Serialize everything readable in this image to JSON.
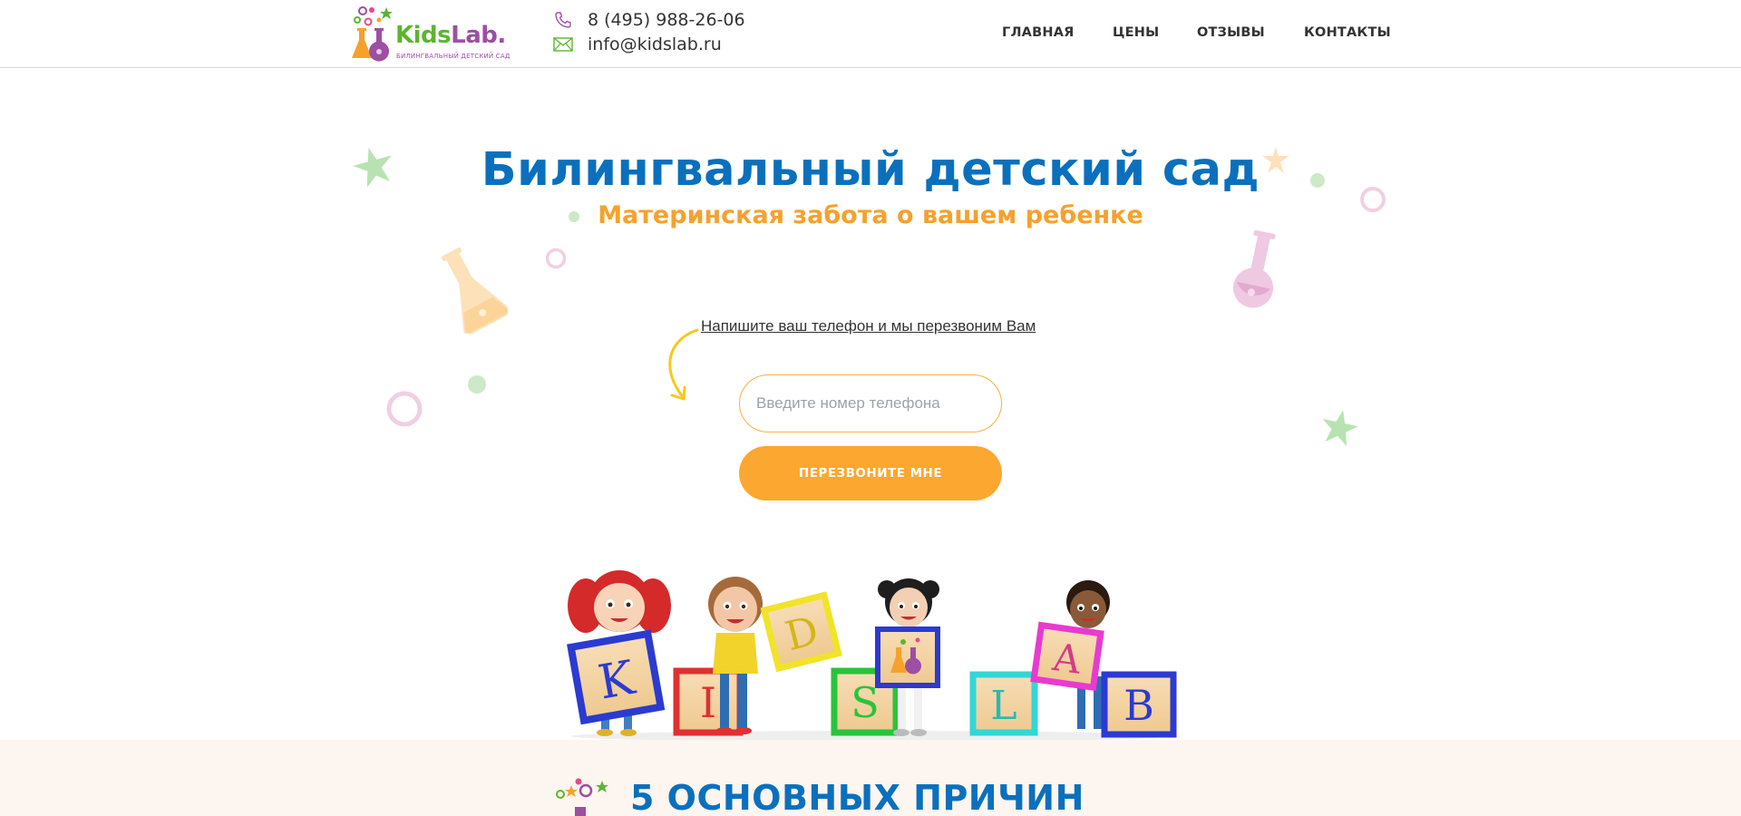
{
  "header": {
    "logo": {
      "name": "Kids",
      "name_accent": "Lab.",
      "tagline": "БИЛИНГВАЛЬНЫЙ ДЕТСКИЙ САД"
    },
    "phone": "8 (495) 988-26-06",
    "email": "info@kidslab.ru",
    "nav": [
      {
        "label": "ГЛАВНАЯ"
      },
      {
        "label": "ЦЕНЫ"
      },
      {
        "label": "ОТЗЫВЫ"
      },
      {
        "label": "КОНТАКТЫ"
      }
    ]
  },
  "hero": {
    "title": "Билингвальный детский сад",
    "subtitle": "Материнская забота о вашем ребенке",
    "callback_hint": "Напишите ваш телефон и мы перезвоним Вам",
    "phone_placeholder": "Введите номер телефона",
    "phone_value": "",
    "button_label": "ПЕРЕЗВОНИТЕ МНЕ",
    "blocks": [
      "K",
      "I",
      "D",
      "S",
      "L",
      "A",
      "B"
    ]
  },
  "reasons": {
    "title": "5 ОСНОВНЫХ ПРИЧИН"
  },
  "colors": {
    "brand_blue": "#0a70bd",
    "brand_orange": "#f6a12c",
    "button_orange": "#fca72f",
    "brand_green": "#5cb531",
    "brand_purple": "#9c4fa3"
  }
}
